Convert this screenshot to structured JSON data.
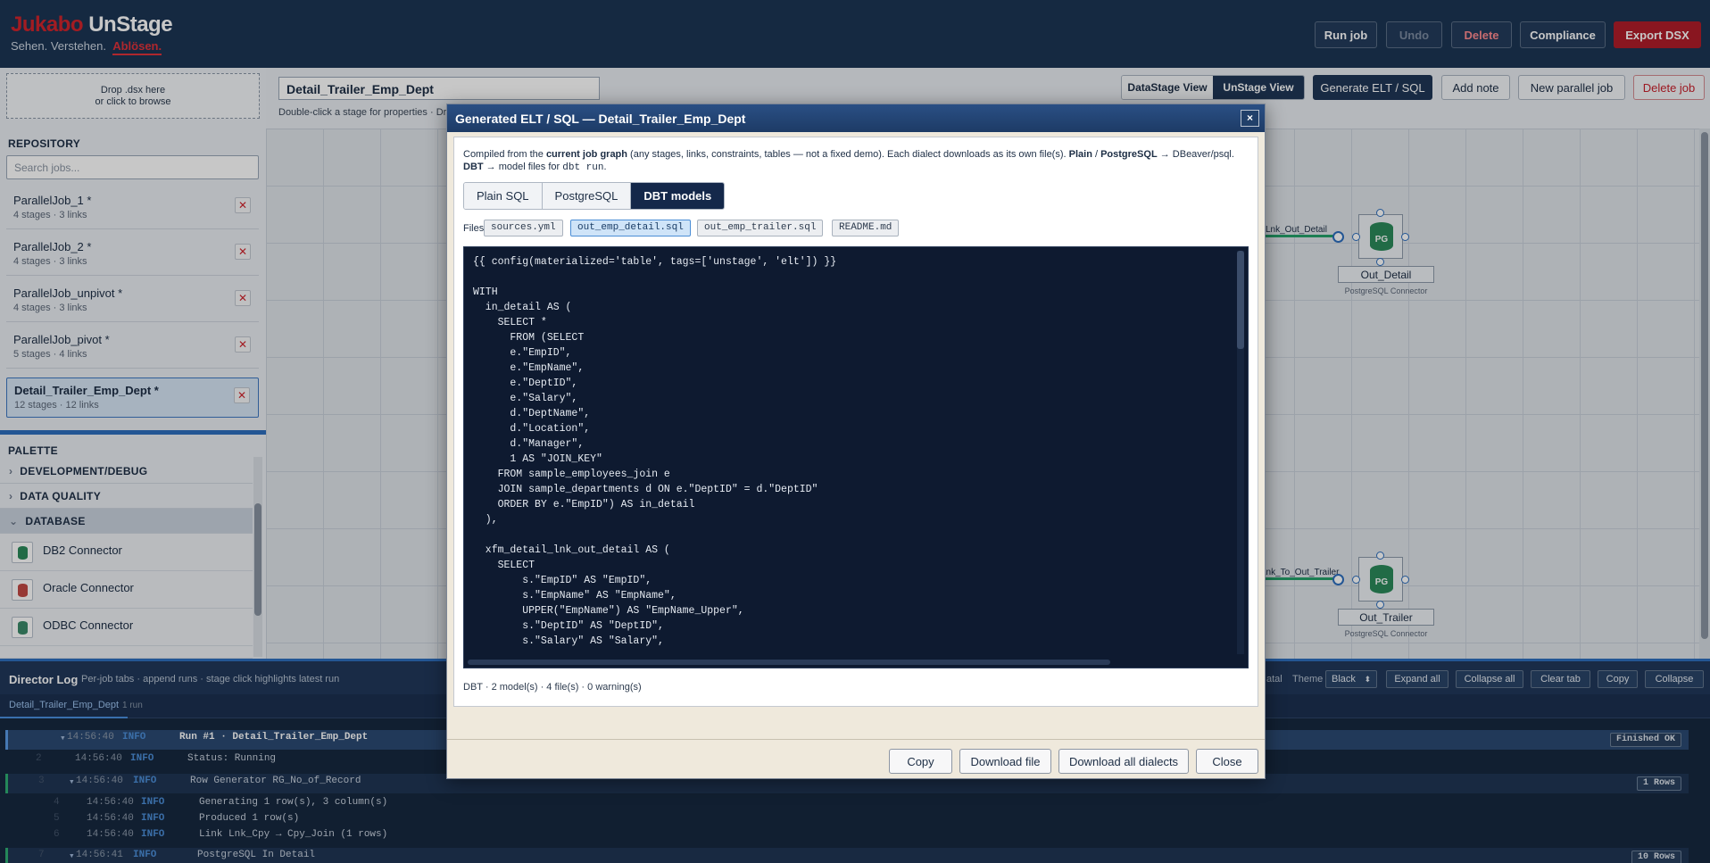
{
  "header": {
    "logo_red": "Jukabo",
    "logo_white": "UnStage",
    "tagline_1": "Sehen. Verstehen.",
    "tagline_2": "Ablösen.",
    "buttons": {
      "run_job": "Run job",
      "undo": "Undo",
      "delete": "Delete",
      "compliance": "Compliance",
      "export_dsx": "Export DSX"
    }
  },
  "sidebar": {
    "drop_line1": "Drop .dsx here",
    "drop_line2": "or click to browse",
    "repository_title": "REPOSITORY",
    "search_placeholder": "Search jobs...",
    "jobs": [
      {
        "name": "ParallelJob_1 *",
        "meta": "4 stages · 3 links"
      },
      {
        "name": "ParallelJob_2 *",
        "meta": "4 stages · 3 links"
      },
      {
        "name": "ParallelJob_unpivot *",
        "meta": "4 stages · 3 links"
      },
      {
        "name": "ParallelJob_pivot *",
        "meta": "5 stages · 4 links"
      },
      {
        "name": "Detail_Trailer_Emp_Dept *",
        "meta": "12 stages · 12 links"
      }
    ],
    "remove_symbol": "✕",
    "palette_title": "PALETTE",
    "palette_categories": [
      "DEVELOPMENT/DEBUG",
      "DATA QUALITY",
      "DATABASE"
    ],
    "palette_items": [
      "DB2 Connector",
      "Oracle Connector",
      "ODBC Connector"
    ],
    "collapsed_arrow": "›",
    "expanded_arrow": "⌄"
  },
  "job_toolbar": {
    "job_name": "Detail_Trailer_Emp_Dept",
    "hint": "Double-click a stage for properties · Dr",
    "datastage_view": "DataStage View",
    "unstage_view": "UnStage View",
    "generate": "Generate ELT / SQL",
    "add_note": "Add note",
    "new_parallel_job": "New parallel job",
    "delete_job": "Delete job"
  },
  "canvas": {
    "stages": [
      {
        "label": "Out_Detail",
        "sub": "PostgreSQL Connector",
        "link_label": "Lnk_Out_Detail",
        "icon_text": "PG"
      },
      {
        "label": "Out_Trailer",
        "sub": "PostgreSQL Connector",
        "link_label": "Lnk_To_Out_Trailer",
        "icon_text": "PG"
      }
    ]
  },
  "modal": {
    "title": "Generated ELT / SQL — Detail_Trailer_Emp_Dept",
    "close_symbol": "×",
    "desc_1": "Compiled from the ",
    "desc_bold_1": "current job graph",
    "desc_2": " (any stages, links, constraints, tables — not a fixed demo). Each dialect downloads as its own file(s). ",
    "desc_bold_2": "Plain",
    "desc_3": " / ",
    "desc_bold_3": "PostgreSQL",
    "desc_4": " → DBeaver/psql.",
    "desc_bold_4": "DBT",
    "desc_5": " → model files for ",
    "desc_code": "dbt run",
    "desc_6": ".",
    "dialect_tabs": [
      "Plain SQL",
      "PostgreSQL",
      "DBT models"
    ],
    "active_tab": "DBT models",
    "files_label": "Files:",
    "files": [
      "sources.yml",
      "out_emp_detail.sql",
      "out_emp_trailer.sql",
      "README.md"
    ],
    "active_file": "out_emp_detail.sql",
    "code": "{{ config(materialized='table', tags=['unstage', 'elt']) }}\n\nWITH\n  in_detail AS (\n    SELECT *\n      FROM (SELECT\n      e.\"EmpID\",\n      e.\"EmpName\",\n      e.\"DeptID\",\n      e.\"Salary\",\n      d.\"DeptName\",\n      d.\"Location\",\n      d.\"Manager\",\n      1 AS \"JOIN_KEY\"\n    FROM sample_employees_join e\n    JOIN sample_departments d ON e.\"DeptID\" = d.\"DeptID\"\n    ORDER BY e.\"EmpID\") AS in_detail\n  ),\n\n  xfm_detail_lnk_out_detail AS (\n    SELECT\n        s.\"EmpID\" AS \"EmpID\",\n        s.\"EmpName\" AS \"EmpName\",\n        UPPER(\"EmpName\") AS \"EmpName_Upper\",\n        s.\"DeptID\" AS \"DeptID\",\n        s.\"Salary\" AS \"Salary\",",
    "status": "DBT · 2 model(s) · 4 file(s) · 0 warning(s)",
    "footer": {
      "copy": "Copy",
      "download_file": "Download file",
      "download_all": "Download all dialects",
      "close": "Close"
    }
  },
  "director_log": {
    "title": "Director Log",
    "hint": "Per-job tabs · append runs · stage click highlights latest run",
    "fatal_label": "atal",
    "theme_label": "Theme",
    "theme_value": "Black",
    "select_arrows": "⬍",
    "buttons": [
      "Expand all",
      "Collapse all",
      "Clear tab",
      "Copy",
      "Collapse"
    ],
    "tab": "Detail_Trailer_Emp_Dept",
    "tab_runs": "1 run",
    "rows": [
      {
        "num": "",
        "ts": "14:56:40",
        "level": "INFO",
        "msg": "Run #1  · Detail_Trailer_Emp_Dept",
        "badge": "Finished OK"
      },
      {
        "num": "2",
        "ts": "14:56:40",
        "level": "INFO",
        "msg": "Status: Running",
        "badge": ""
      },
      {
        "num": "3",
        "ts": "14:56:40",
        "level": "INFO",
        "msg": "Row Generator RG_No_of_Record",
        "badge": "1 Rows"
      },
      {
        "num": "4",
        "ts": "14:56:40",
        "level": "INFO",
        "msg": "Generating 1 row(s), 3 column(s)",
        "badge": ""
      },
      {
        "num": "5",
        "ts": "14:56:40",
        "level": "INFO",
        "msg": "Produced 1 row(s)",
        "badge": ""
      },
      {
        "num": "6",
        "ts": "14:56:40",
        "level": "INFO",
        "msg": "Link Lnk_Cpy → Cpy_Join (1 rows)",
        "badge": ""
      },
      {
        "num": "7",
        "ts": "14:56:41",
        "level": "INFO",
        "msg": "PostgreSQL In Detail",
        "badge": "10 Rows"
      }
    ]
  },
  "colors": {
    "brand_red": "#d0242c",
    "header_bg": "#1c3554",
    "accent_blue": "#2d6fbe",
    "link_green": "#26a26b",
    "code_bg": "#0e1a30"
  }
}
